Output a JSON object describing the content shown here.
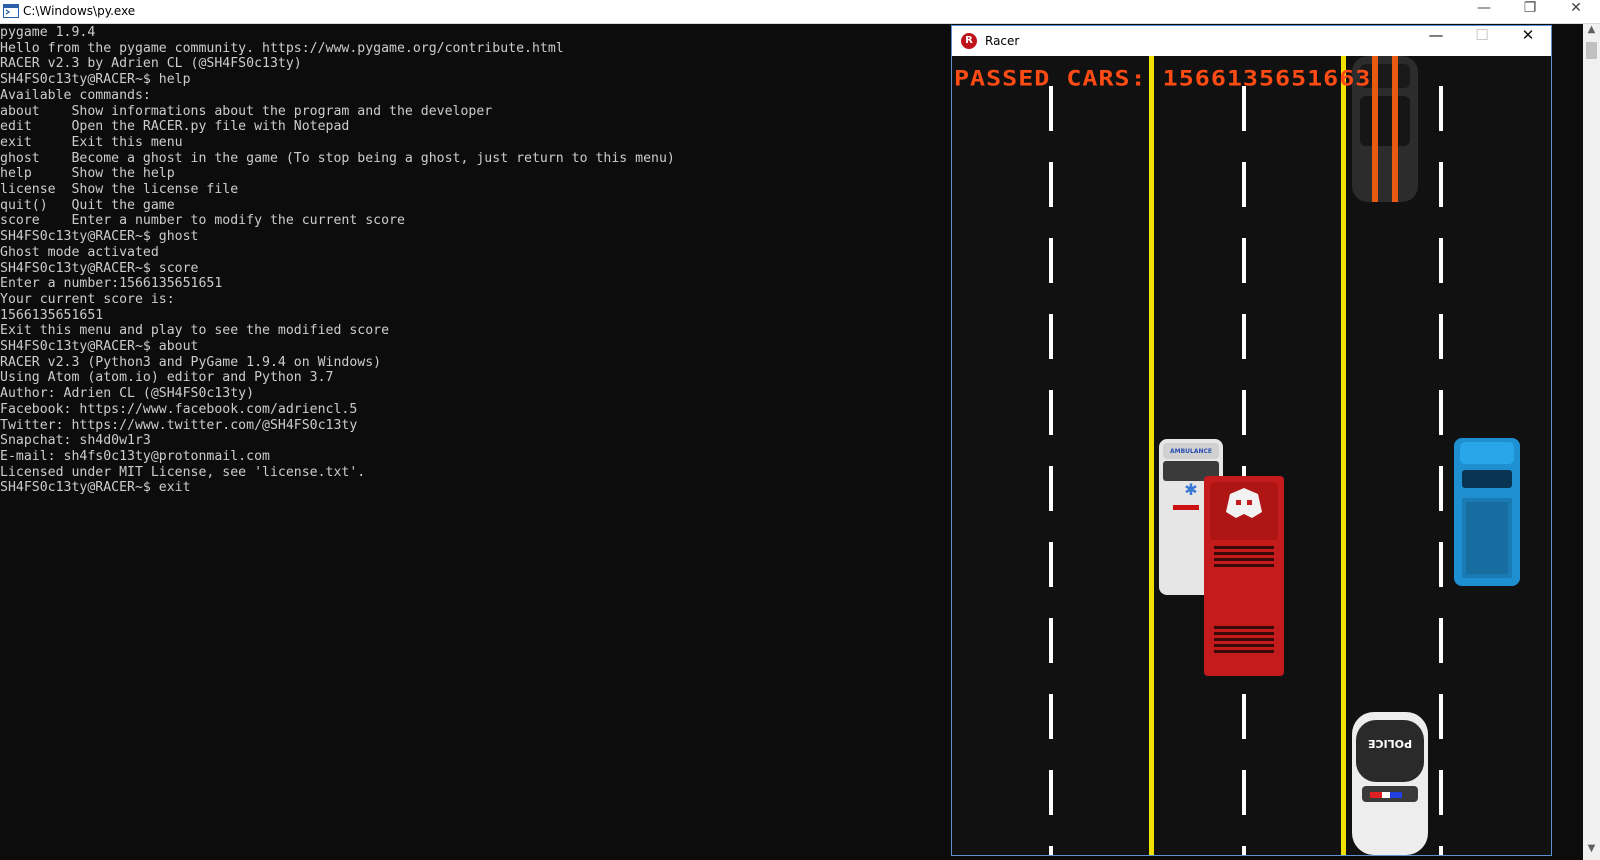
{
  "console": {
    "title": "C:\\Windows\\py.exe",
    "lines": [
      "pygame 1.9.4",
      "Hello from the pygame community. https://www.pygame.org/contribute.html",
      "RACER v2.3 by Adrien CL (@SH4FS0c13ty)",
      "SH4FS0c13ty@RACER~$ help",
      "Available commands:",
      "about    Show informations about the program and the developer",
      "edit     Open the RACER.py file with Notepad",
      "exit     Exit this menu",
      "ghost    Become a ghost in the game (To stop being a ghost, just return to this menu)",
      "help     Show the help",
      "license  Show the license file",
      "quit()   Quit the game",
      "score    Enter a number to modify the current score",
      "SH4FS0c13ty@RACER~$ ghost",
      "Ghost mode activated",
      "SH4FS0c13ty@RACER~$ score",
      "Enter a number:1566135651651",
      "Your current score is:",
      "1566135651651",
      "Exit this menu and play to see the modified score",
      "SH4FS0c13ty@RACER~$ about",
      "RACER v2.3 (Python3 and PyGame 1.9.4 on Windows)",
      "Using Atom (atom.io) editor and Python 3.7",
      "Author: Adrien CL (@SH4FS0c13ty)",
      "Facebook: https://www.facebook.com/adriencl.5",
      "Twitter: https://www.twitter.com/@SH4FS0c13ty",
      "Snapchat: sh4d0w1r3",
      "E-mail: sh4fs0c13ty@protonmail.com",
      "Licensed under MIT License, see 'license.txt'.",
      "SH4FS0c13ty@RACER~$ exit"
    ]
  },
  "racer": {
    "title": "Racer",
    "score_text": "Passed cars: 1566135651663"
  },
  "icons": {
    "console_icon": "console-window-icon",
    "racer_icon": "racer-app-icon",
    "minimize": "minimize-icon",
    "maximize": "maximize-icon",
    "restore": "restore-icon",
    "close": "close-icon"
  },
  "colors": {
    "console_bg": "#0c0c0c",
    "console_text": "#cccccc",
    "road": "#111111",
    "lane_yellow": "#f0e000",
    "score": "#ff4b14"
  },
  "glyphs": {
    "minimize": "—",
    "maximize": "☐",
    "restore": "❐",
    "close": "✕",
    "scroll_up": "▲",
    "scroll_down": "▼"
  }
}
